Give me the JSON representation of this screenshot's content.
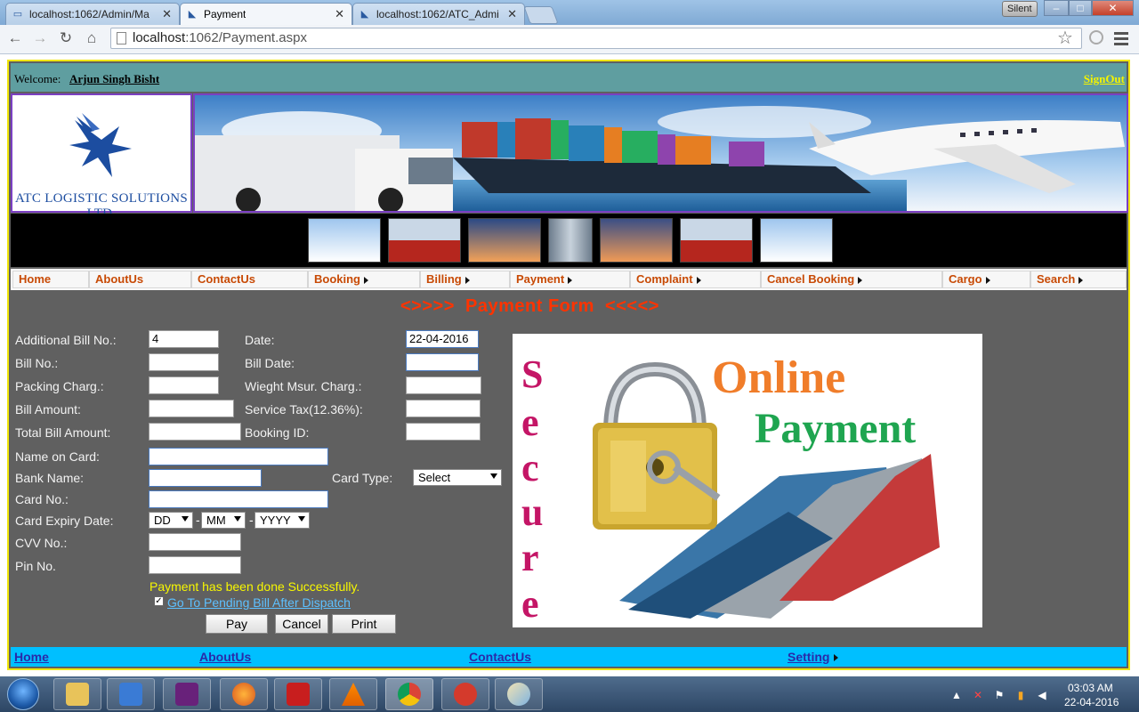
{
  "browser": {
    "tabs": [
      {
        "label": "localhost:1062/Admin/Ma"
      },
      {
        "label": "Payment"
      },
      {
        "label": "localhost:1062/ATC_Admi"
      }
    ],
    "badge": "Silent",
    "url_host": "localhost",
    "url_rest": ":1062/Payment.aspx",
    "window_controls": {
      "minimize": "–",
      "maximize": "□",
      "close": "✕"
    }
  },
  "header": {
    "welcome_label": "Welcome:",
    "user_name": "Arjun Singh Bisht",
    "signout": "SignOut",
    "logo_text": "ATC LOGISTIC SOLUTIONS LTD."
  },
  "nav": {
    "items": [
      {
        "label": "Home"
      },
      {
        "label": "AboutUs"
      },
      {
        "label": "ContactUs"
      },
      {
        "label": "Booking"
      },
      {
        "label": "Billing"
      },
      {
        "label": "Payment"
      },
      {
        "label": "Complaint"
      },
      {
        "label": "Cancel Booking"
      },
      {
        "label": "Cargo"
      },
      {
        "label": "Search"
      }
    ]
  },
  "form": {
    "title": "<>>>>  Payment Form  <<<<>",
    "labels": {
      "additional_bill_no": "Additional Bill No.:",
      "date": "Date:",
      "bill_no": "Bill No.:",
      "bill_date": "Bill Date:",
      "packing_charg": "Packing Charg.:",
      "weight_msur_charg": "Wieght Msur. Charg.:",
      "bill_amount": "Bill Amount:",
      "service_tax": "Service Tax(12.36%):",
      "total_bill_amount": "Total Bill Amount:",
      "booking_id": "Booking ID:",
      "name_on_card": "Name on Card:",
      "bank_name": "Bank Name:",
      "card_type": "Card Type:",
      "card_no": "Card No.:",
      "card_expiry_date": "Card Expiry Date:",
      "cvv_no": "CVV No.:",
      "pin_no": "Pin No."
    },
    "values": {
      "additional_bill_no": "4",
      "date": "22-04-2016"
    },
    "selects": {
      "card_type": "Select",
      "expiry_day": "DD",
      "expiry_month": "MM",
      "expiry_year": "YYYY"
    },
    "separator": "-",
    "success_message": "Payment has been done Successfully.",
    "checkbox_mark": "✓",
    "pending_link": "Go To Pending Bill After Dispatch",
    "buttons": {
      "pay": "Pay",
      "cancel": "Cancel",
      "print": "Print"
    }
  },
  "secure_image": {
    "vertical_word": [
      "S",
      "e",
      "c",
      "u",
      "r",
      "e"
    ],
    "line1": "Online",
    "line2": "Payment"
  },
  "footer": {
    "links": [
      {
        "label": "Home"
      },
      {
        "label": "AboutUs"
      },
      {
        "label": "ContactUs"
      },
      {
        "label": "Setting"
      }
    ]
  },
  "taskbar": {
    "time": "03:03 AM",
    "date": "22-04-2016"
  }
}
